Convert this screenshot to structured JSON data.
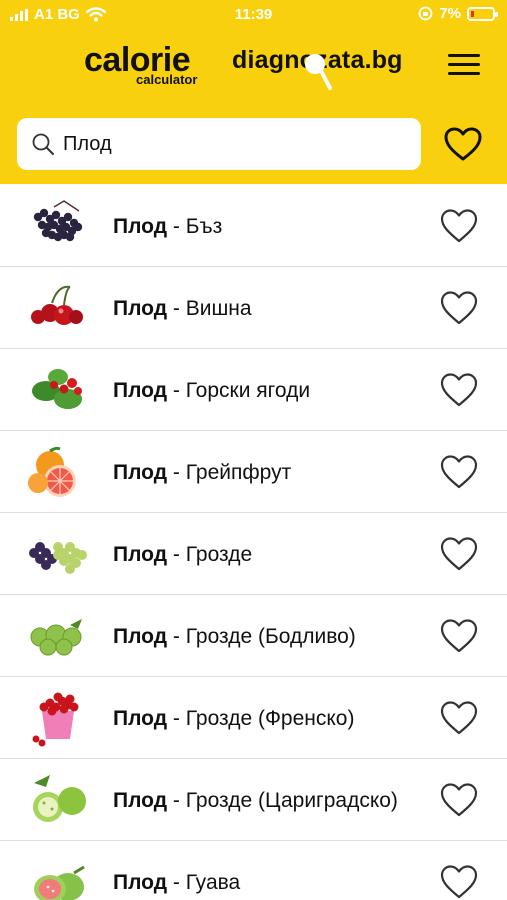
{
  "status_bar": {
    "carrier": "A1 BG",
    "time": "11:39",
    "battery": "7%"
  },
  "header": {
    "logo_main": "calorie",
    "logo_sub": "calculator",
    "brand": "diagnozata.bg",
    "menu_icon": "hamburger-menu-icon",
    "favorites_icon": "heart-outline-icon"
  },
  "search": {
    "value": "Плод",
    "icon": "search-icon"
  },
  "colors": {
    "header_bg": "#f9d00d",
    "text": "#111111",
    "divider": "#dedede"
  },
  "results": [
    {
      "prefix": "Плод",
      "separator": " - ",
      "name": "Бъз",
      "image": "elderberry"
    },
    {
      "prefix": "Плод",
      "separator": " - ",
      "name": "Вишна",
      "image": "sour-cherry"
    },
    {
      "prefix": "Плод",
      "separator": " - ",
      "name": "Горски ягоди",
      "image": "wild-strawberry"
    },
    {
      "prefix": "Плод",
      "separator": " - ",
      "name": "Грейпфрут",
      "image": "grapefruit"
    },
    {
      "prefix": "Плод",
      "separator": " - ",
      "name": "Грозде",
      "image": "grapes"
    },
    {
      "prefix": "Плод",
      "separator": " - ",
      "name": "Грозде (Бодливо)",
      "image": "gooseberry"
    },
    {
      "prefix": "Плод",
      "separator": " - ",
      "name": "Грозде (Френско)",
      "image": "redcurrant-bucket"
    },
    {
      "prefix": "Плод",
      "separator": " - ",
      "name": "Грозде (Цариградско)",
      "image": "green-gooseberry"
    },
    {
      "prefix": "Плод",
      "separator": " - ",
      "name": "Гуава",
      "image": "guava"
    }
  ]
}
